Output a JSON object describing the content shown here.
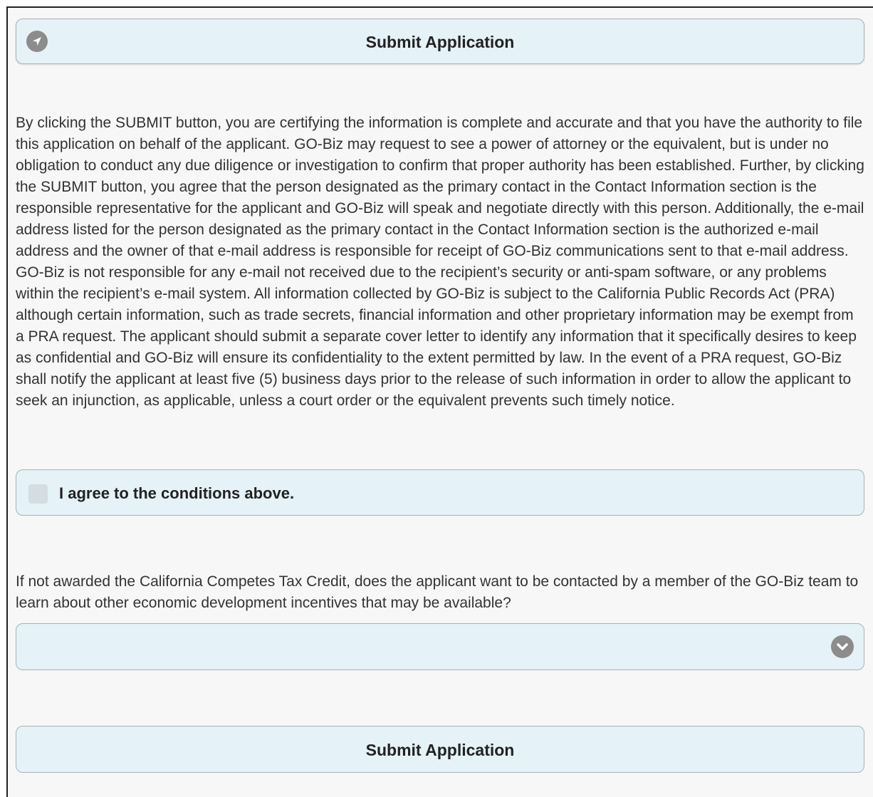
{
  "header": {
    "title": "Submit Application",
    "icon": "navigation-arrow-icon"
  },
  "certification": {
    "text": "By clicking the SUBMIT button, you are certifying the information is complete and accurate and that you have the authority to file this application on behalf of the applicant. GO-Biz may request to see a power of attorney or the equivalent, but is under no obligation to conduct any due diligence or investigation to confirm that proper authority has been established. Further, by clicking the SUBMIT button, you agree that the person designated as the primary contact in the Contact Information section is the responsible representative for the applicant and GO-Biz will speak and negotiate directly with this person. Additionally, the e-mail address listed for the person designated as the primary contact in the Contact Information section is the authorized e-mail address and the owner of that e-mail address is responsible for receipt of GO-Biz communications sent to that e-mail address. GO-Biz is not responsible for any e-mail not received due to the recipient’s security or anti-spam software, or any problems within the recipient’s e-mail system. All information collected by GO-Biz is subject to the California Public Records Act (PRA) although certain information, such as trade secrets, financial information and other proprietary information may be exempt from a PRA request. The applicant should submit a separate cover letter to identify any information that it specifically desires to keep as confidential and GO-Biz will ensure its confidentiality to the extent permitted by law. In the event of a PRA request, GO-Biz shall notify the applicant at least five (5) business days prior to the release of such information in order to allow the applicant to seek an injunction, as applicable, unless a court order or the equivalent prevents such timely notice."
  },
  "agree": {
    "label": "I agree to the conditions above.",
    "checked": false
  },
  "contact_question": {
    "text": "If not awarded the California Competes Tax Credit, does the applicant want to be contacted by a member of the GO-Biz team to learn about other economic development incentives that may be available?",
    "selected_value": "",
    "icon": "chevron-down-icon"
  },
  "submit": {
    "label": "Submit Application"
  },
  "colors": {
    "panel_background": "#e5f2f7",
    "panel_border": "#a8b2b7",
    "icon_gray": "#8c8c8c",
    "page_background": "#f7f7f7"
  }
}
